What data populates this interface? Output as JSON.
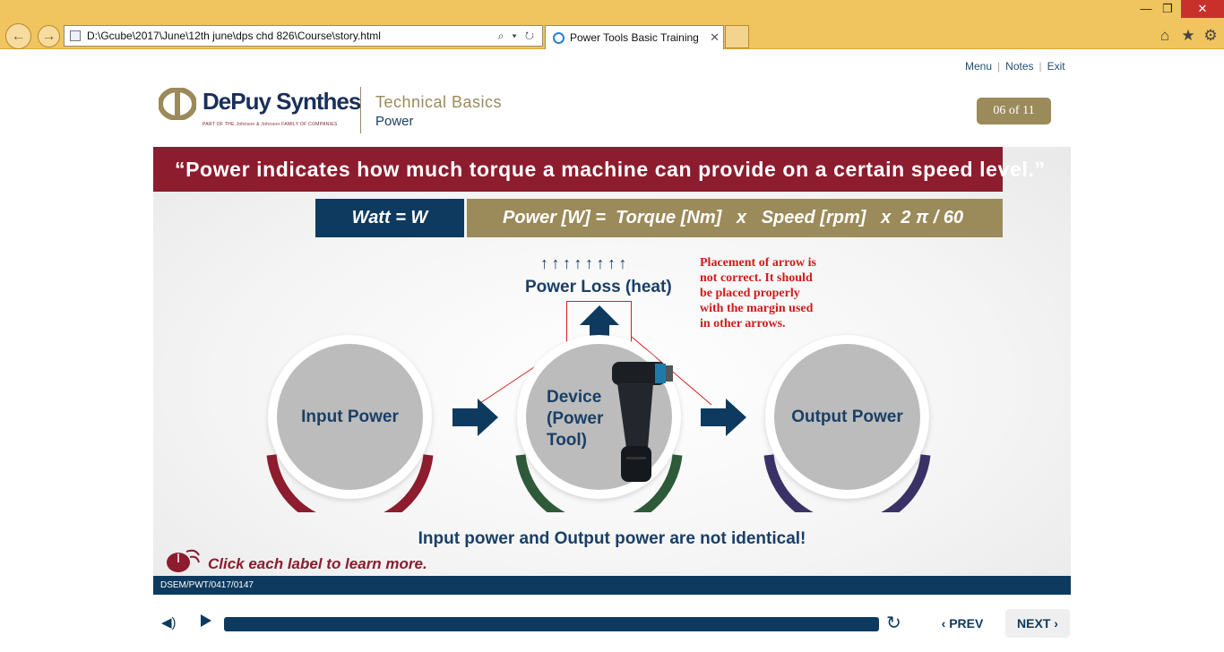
{
  "browser": {
    "address": "D:\\Gcube\\2017\\June\\12th june\\dps chd 826\\Course\\story.html",
    "address_tools": "⌕ ▾ ↻",
    "tab_title": "Power Tools Basic Training",
    "tab_close": "✕",
    "back": "←",
    "forward": "→",
    "minimize": "—",
    "maximize": "❐",
    "close": "✕",
    "home_icon": "⌂",
    "favorites_icon": "★",
    "settings_icon": "⚙"
  },
  "top_links": {
    "menu": "Menu",
    "notes": "Notes",
    "exit": "Exit",
    "separator": "|"
  },
  "logo": {
    "name": "DePuy Synthes",
    "tagline": "PART OF THE Johnson & Johnson FAMILY OF COMPANIES"
  },
  "course": {
    "title": "Technical Basics",
    "subtitle": "Power"
  },
  "page_counter": "06 of 11",
  "slide": {
    "quote": "“Power indicates how much torque a machine can provide on a certain speed level.”",
    "watt": "Watt = W",
    "formula": "Power [W] =  Torque [Nm]   x   Speed [rpm]   x  2 π / 60",
    "small_arrows": "↑↑↑↑↑↑↑↑",
    "loss_label": "Power Loss (heat)",
    "review_note": "Placement of arrow is not correct. It should be placed properly with the margin used in other arrows.",
    "input_label": "Input Power",
    "device_label_1": "Device",
    "device_label_2": "(Power",
    "device_label_3": "Tool)",
    "output_label": "Output Power",
    "statement": "Input power and Output power are not identical!",
    "click_hint": "Click each label to learn more."
  },
  "footer_code": "DSEM/PWT/0417/0147",
  "player": {
    "volume_icon": "◀)",
    "replay_icon": "↻",
    "prev": "‹  PREV",
    "next": "NEXT  ›"
  },
  "colors": {
    "navy": "#0e3a5f",
    "maroon": "#8c1c2e",
    "gold": "#9b8a5a",
    "green_arc": "#2f5a3a",
    "purple_arc": "#3a3266",
    "chrome": "#f0c45e"
  }
}
